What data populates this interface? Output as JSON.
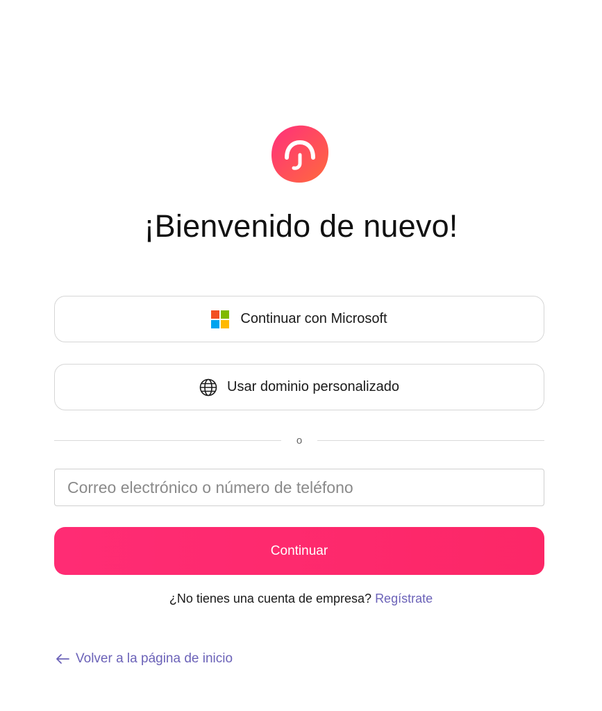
{
  "brand": {
    "logo_icon": "headset-logo-icon",
    "gradient_start": "#ff2f7c",
    "gradient_end": "#ff6a3d"
  },
  "header": {
    "title": "¡Bienvenido de nuevo!"
  },
  "auth_options": {
    "microsoft_label": "Continuar con Microsoft",
    "microsoft_icon": "microsoft-logo-icon",
    "custom_domain_label": "Usar dominio personalizado",
    "custom_domain_icon": "globe-icon"
  },
  "divider": {
    "label": "o"
  },
  "login_form": {
    "identifier_placeholder": "Correo electrónico o número de teléfono",
    "identifier_value": "",
    "submit_label": "Continuar",
    "submit_color": "#ff2a6d"
  },
  "signup": {
    "prompt": "¿No tienes una cuenta de empresa?",
    "link_label": "Regístrate",
    "link_color": "#6b62b8"
  },
  "footer": {
    "back_label": "Volver a la página de inicio",
    "back_icon": "arrow-left-icon"
  }
}
